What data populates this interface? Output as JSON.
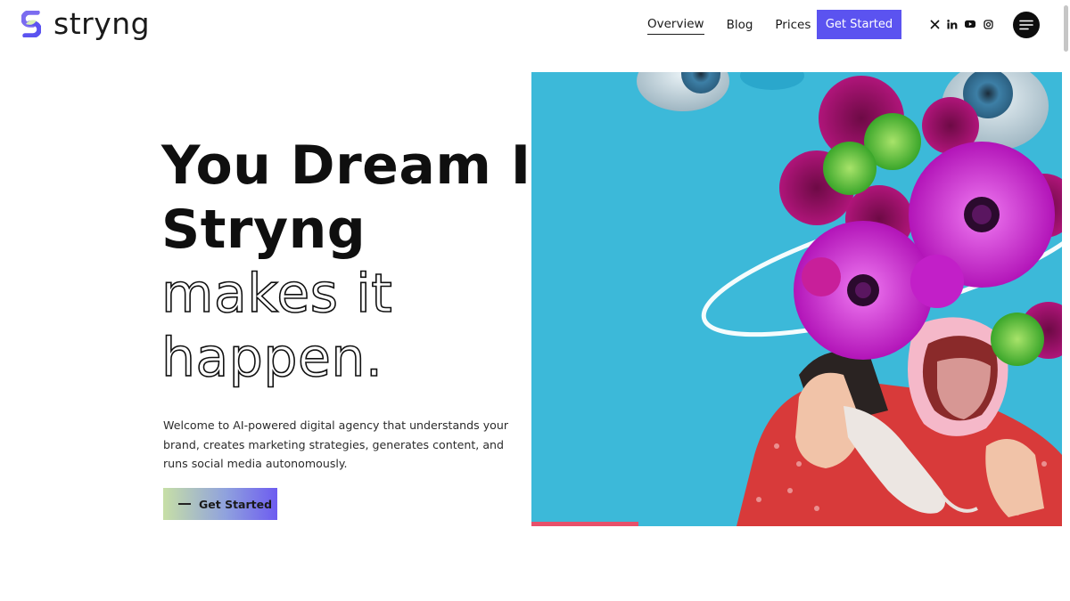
{
  "brand": {
    "name": "stryng"
  },
  "nav": {
    "items": [
      {
        "label": "Overview",
        "active": true
      },
      {
        "label": "Blog"
      },
      {
        "label": "Prices"
      }
    ],
    "cta_label": "Get Started",
    "social": [
      "x-icon",
      "linkedin-icon",
      "youtube-icon",
      "instagram-icon"
    ],
    "menu_icon": "hamburger-menu-icon"
  },
  "hero": {
    "headline_lines": [
      "You Dream It,",
      "Stryng",
      "makes it",
      "happen."
    ],
    "intro": "Welcome to AI-powered digital agency that understands your brand, creates marketing strategies, generates content, and runs social media autonomously.",
    "cta_label": "Get Started"
  },
  "colors": {
    "accent": "#5b53f0",
    "image_background": "#3cb9d9",
    "flower_magenta": "#c21fc8",
    "flower_green": "#59c33a"
  }
}
